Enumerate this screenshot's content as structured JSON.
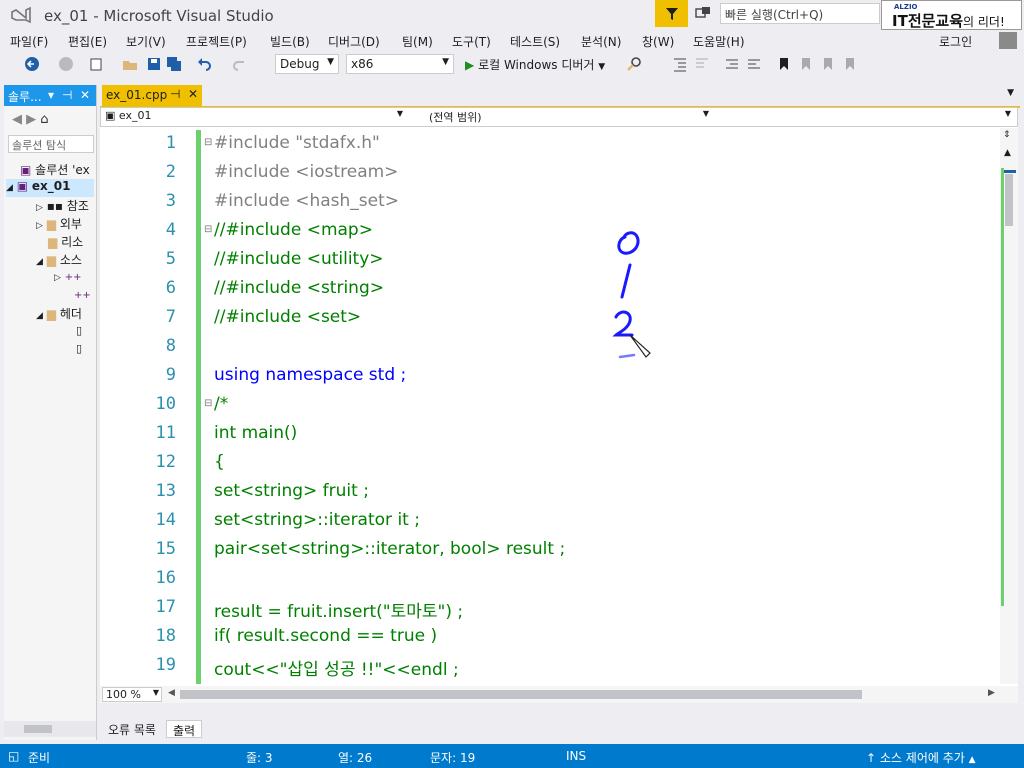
{
  "window": {
    "title": "ex_01 - Microsoft Visual Studio"
  },
  "quick_launch": {
    "placeholder": "빠른 실행(Ctrl+Q)"
  },
  "brand": {
    "small": "ALZIO",
    "main": "IT전문교육",
    "suffix": "의 리더!"
  },
  "menu": [
    "파일(F)",
    "편집(E)",
    "보기(V)",
    "프로젝트(P)",
    "빌드(B)",
    "디버그(D)",
    "팀(M)",
    "도구(T)",
    "테스트(S)",
    "분석(N)",
    "창(W)",
    "도움말(H)"
  ],
  "account": {
    "login": "로그인"
  },
  "toolbar": {
    "config": "Debug",
    "platform": "x86",
    "debug_button": "로컬 Windows 디버거"
  },
  "solution": {
    "tab_label": "솔루...",
    "search_placeholder": "솔루션 탐식",
    "items": [
      "솔루션 'ex",
      "ex_01",
      "참조",
      "외부",
      "리소",
      "소스",
      "",
      "",
      "헤더",
      "",
      ""
    ]
  },
  "editor": {
    "tab": "ex_01.cpp",
    "nav_project": "ex_01",
    "nav_scope": "(전역 범위)",
    "zoom": "100 %",
    "lines": [
      {
        "n": "1",
        "t": "#include \"stdafx.h\""
      },
      {
        "n": "2",
        "t": "#include <iostream>"
      },
      {
        "n": "3",
        "t": "#include <hash_set>"
      },
      {
        "n": "4",
        "t": "//#include <map>"
      },
      {
        "n": "5",
        "t": "//#include <utility>"
      },
      {
        "n": "6",
        "t": "//#include <string>"
      },
      {
        "n": "7",
        "t": "//#include <set>"
      },
      {
        "n": "8",
        "t": ""
      },
      {
        "n": "9",
        "t": "using namespace std ;"
      },
      {
        "n": "10",
        "t": "/*"
      },
      {
        "n": "11",
        "t": "int main()"
      },
      {
        "n": "12",
        "t": "{"
      },
      {
        "n": "13",
        "t": "set<string> fruit ;"
      },
      {
        "n": "14",
        "t": "set<string>::iterator it ;"
      },
      {
        "n": "15",
        "t": "pair<set<string>::iterator, bool> result ;"
      },
      {
        "n": "16",
        "t": ""
      },
      {
        "n": "17",
        "t": "result = fruit.insert(\"토마토\") ;"
      },
      {
        "n": "18",
        "t": "if( result.second == true )"
      },
      {
        "n": "19",
        "t": "cout<<\"삽입 성공 !!\"<<endl ;"
      }
    ]
  },
  "bottom_tabs": {
    "errors": "오류 목록",
    "output": "출력"
  },
  "status": {
    "ready": "준비",
    "line": "줄: 3",
    "col": "열: 26",
    "char": "문자: 19",
    "mode": "INS",
    "source_control": "소스 제어에 추가"
  },
  "colors": {
    "accent": "#007acc",
    "tab_active": "#f0c000",
    "change_bar": "#6cd16c",
    "ink": "#1a1aff"
  }
}
